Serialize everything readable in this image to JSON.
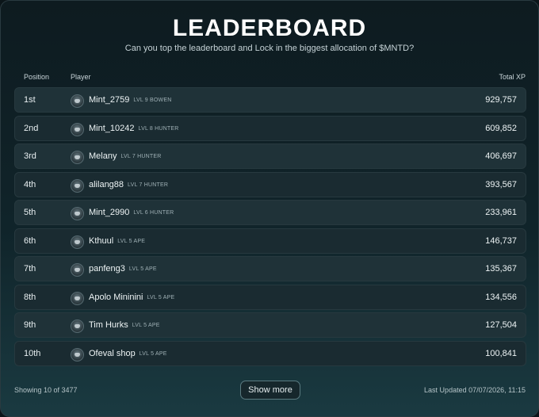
{
  "header": {
    "title": "LEADERBOARD",
    "subtitle": "Can you top the leaderboard and Lock in the biggest allocation of $MNTD?"
  },
  "columns": {
    "position": "Position",
    "player": "Player",
    "total_xp": "Total XP"
  },
  "rows": [
    {
      "position": "1st",
      "name": "Mint_2759",
      "level": "LVL 9 BOWEN",
      "xp": "929,757"
    },
    {
      "position": "2nd",
      "name": "Mint_10242",
      "level": "LVL 8 HUNTER",
      "xp": "609,852"
    },
    {
      "position": "3rd",
      "name": "Melany",
      "level": "LVL 7 HUNTER",
      "xp": "406,697"
    },
    {
      "position": "4th",
      "name": "alilang88",
      "level": "LVL 7 HUNTER",
      "xp": "393,567"
    },
    {
      "position": "5th",
      "name": "Mint_2990",
      "level": "LVL 6 HUNTER",
      "xp": "233,961"
    },
    {
      "position": "6th",
      "name": "Kthuul",
      "level": "LVL 5 APE",
      "xp": "146,737"
    },
    {
      "position": "7th",
      "name": "panfeng3",
      "level": "LVL 5 APE",
      "xp": "135,367"
    },
    {
      "position": "8th",
      "name": "Apolo Mininini",
      "level": "LVL 5 APE",
      "xp": "134,556"
    },
    {
      "position": "9th",
      "name": "Tim Hurks",
      "level": "LVL 5 APE",
      "xp": "127,504"
    },
    {
      "position": "10th",
      "name": "Ofeval shop",
      "level": "LVL 5 APE",
      "xp": "100,841"
    }
  ],
  "footer": {
    "showing": "Showing 10 of 3477",
    "show_more": "Show more",
    "last_updated": "Last Updated 07/07/2026, 11:15"
  },
  "icons": {
    "avatar": "player-avatar-icon"
  }
}
